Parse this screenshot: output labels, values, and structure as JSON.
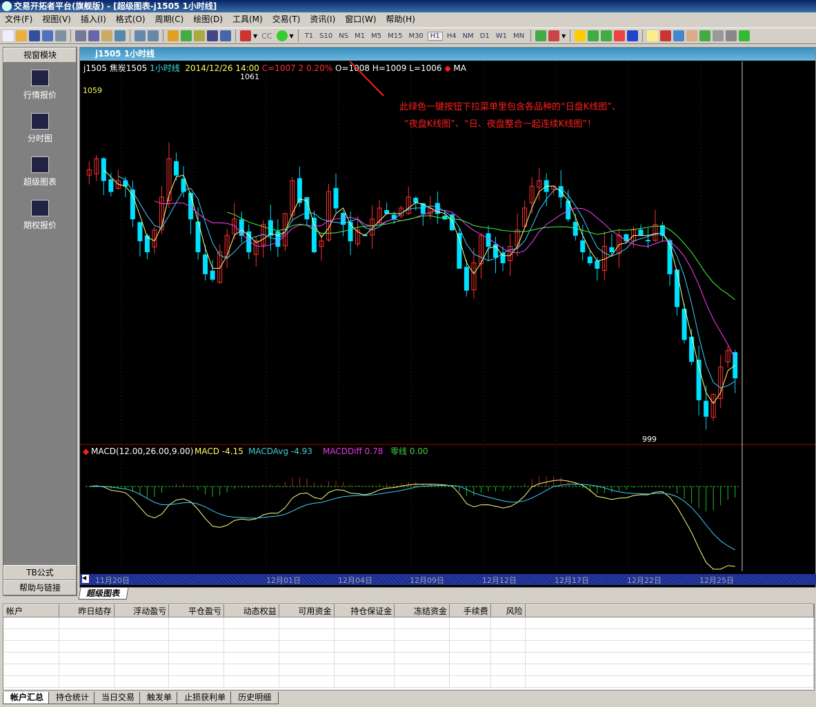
{
  "window": {
    "title": "交易开拓者平台(旗舰版) - [超级图表-j1505 1小时线]"
  },
  "menu": [
    "文件(F)",
    "视图(V)",
    "插入(I)",
    "格式(O)",
    "周期(C)",
    "绘图(D)",
    "工具(M)",
    "交易(T)",
    "资讯(I)",
    "窗口(W)",
    "帮助(H)"
  ],
  "toolbar": {
    "cc_label": "CC",
    "timeframes": [
      "T1",
      "S10",
      "NS",
      "M1",
      "M5",
      "M15",
      "M30",
      "H1",
      "H4",
      "NM",
      "D1",
      "W1",
      "MN"
    ],
    "active_timeframe": "H1"
  },
  "left_panel": {
    "header": "视窗模块",
    "items": [
      "行情报价",
      "分时图",
      "超级图表",
      "期权报价"
    ],
    "footer": [
      "TB公式",
      "帮助与链接"
    ]
  },
  "chart_window": {
    "title": "j1505 1小时线",
    "info": {
      "symbol": "j1505",
      "name": "焦炭1505",
      "period": "1小时线",
      "datetime": "2014/12/26 14:00",
      "change": "C=1007 2 0.20%",
      "ohlc": "O=1008 H=1009 L=1006",
      "indicator": "MA"
    },
    "price_label_top": "1059",
    "high_label": "1061",
    "low_label": "999",
    "annotation": {
      "line1": "此绿色一键按钮下拉菜单里包含各品种的“日盘K线图”、",
      "line2": "“夜盘K线图”、“日、夜盘整合一起连续K线图”！"
    },
    "macd": {
      "title": "MACD(12.00,26.00,9.00)",
      "macd": "MACD -4.15",
      "avg": "MACDAvg -4.93",
      "diff": "MACDDiff 0.78",
      "zero": "零线 0.00"
    },
    "dates": [
      "11月20日",
      "12月01日",
      "12月04日",
      "12月09日",
      "12月12日",
      "12月17日",
      "12月22日",
      "12月25日"
    ],
    "colors": {
      "up": "#ff3030",
      "down": "#00e0ff",
      "ma1": "#ffff80",
      "ma2": "#40d0ff",
      "ma3": "#ff40ff",
      "ma4": "#40ff40",
      "annotation": "#ff2020"
    }
  },
  "chart_data": {
    "type": "candlestick",
    "ylim": [
      995,
      1063
    ],
    "closes": [
      1045,
      1047,
      1043,
      1041,
      1043,
      1042,
      1036,
      1032,
      1030,
      1034,
      1040,
      1047,
      1044,
      1041,
      1036,
      1030,
      1026,
      1025,
      1030,
      1033,
      1036,
      1033,
      1030,
      1032,
      1035,
      1033,
      1031,
      1037,
      1043,
      1039,
      1036,
      1030,
      1032,
      1041,
      1038,
      1035,
      1032,
      1034,
      1033,
      1036,
      1038,
      1037,
      1036,
      1038,
      1040,
      1039,
      1037,
      1038,
      1037,
      1036,
      1034,
      1027,
      1023,
      1028,
      1033,
      1031,
      1029,
      1028,
      1031,
      1034,
      1038,
      1042,
      1043,
      1041,
      1042,
      1040,
      1036,
      1033,
      1030,
      1028,
      1027,
      1031,
      1030,
      1033,
      1032,
      1034,
      1033,
      1032,
      1035,
      1033,
      1026,
      1020,
      1014,
      1010,
      1003,
      1000,
      1004,
      1009,
      1012,
      1007
    ]
  },
  "tab": "超级图表",
  "account_table": {
    "headers": [
      "帐户",
      "昨日结存",
      "浮动盈亏",
      "平仓盈亏",
      "动态权益",
      "可用资金",
      "持仓保证金",
      "冻结资金",
      "手续费",
      "风险"
    ]
  },
  "bottom_tabs": [
    "帐户汇总",
    "持仓统计",
    "当日交易",
    "触发单",
    "止损获利单",
    "历史明细"
  ]
}
